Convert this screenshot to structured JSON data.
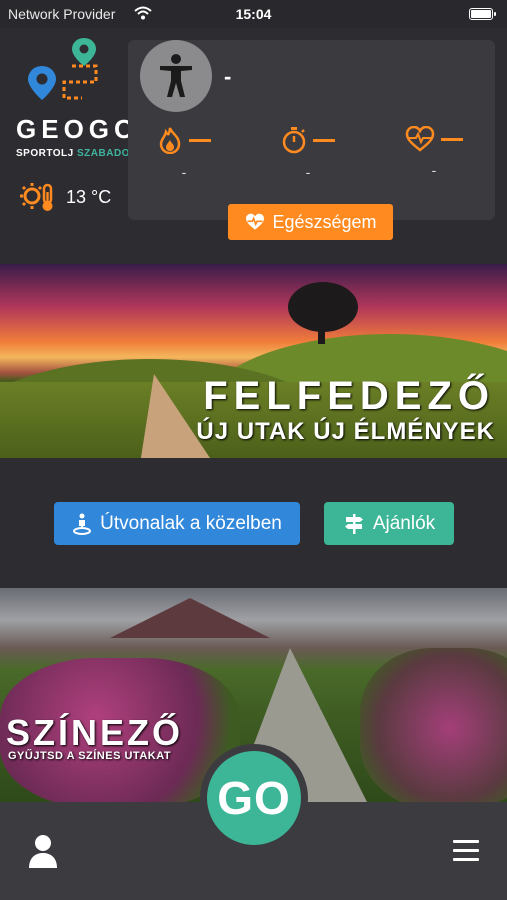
{
  "status_bar": {
    "carrier": "Network Provider",
    "time": "15:04"
  },
  "logo": {
    "wordmark": "GEOGO",
    "tagline_part1": "SPORTOLJ",
    "tagline_part2": "SZABADON"
  },
  "weather": {
    "temperature": "13 °C",
    "icon": "sun-thermometer-icon"
  },
  "health_card": {
    "user_name": "-",
    "stats": [
      {
        "icon": "flame-icon",
        "value": "-"
      },
      {
        "icon": "stopwatch-icon",
        "value": "-"
      },
      {
        "icon": "heart-pulse-icon",
        "value": "-"
      }
    ],
    "button_label": "Egészségem"
  },
  "banner_explorer": {
    "title": "FELFEDEZŐ",
    "subtitle": "ÚJ UTAK ÚJ ÉLMÉNYEK"
  },
  "actions": {
    "routes_label": "Útvonalak a közelben",
    "recommendations_label": "Ajánlók"
  },
  "banner_colorer": {
    "title": "SZÍNEZŐ",
    "subtitle": "GYŰJTSD A SZÍNES UTAKAT"
  },
  "bottom_nav": {
    "go_label": "GO"
  },
  "colors": {
    "accent_orange": "#ff8a1f",
    "accent_blue": "#3187d9",
    "accent_green": "#3db697",
    "background": "#2d2c30"
  }
}
